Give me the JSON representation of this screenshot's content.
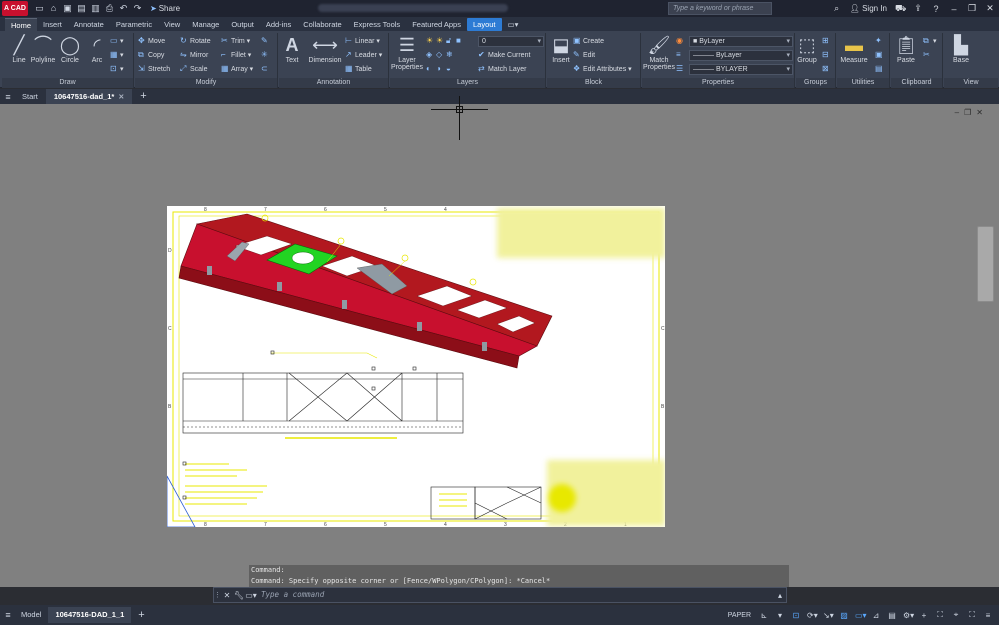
{
  "app": {
    "logo_text": "A CAD",
    "share_label": "Share"
  },
  "search": {
    "placeholder": "Type a keyword or phrase"
  },
  "account": {
    "sign_in_label": "Sign In"
  },
  "ribbon_tabs": [
    "Home",
    "Insert",
    "Annotate",
    "Parametric",
    "View",
    "Manage",
    "Output",
    "Add-ins",
    "Collaborate",
    "Express Tools",
    "Featured Apps",
    "Layout"
  ],
  "panels": {
    "draw": {
      "title": "Draw",
      "tools": [
        "Line",
        "Polyline",
        "Circle",
        "Arc"
      ]
    },
    "modify": {
      "title": "Modify",
      "tools": [
        "Move",
        "Rotate",
        "Trim",
        "Copy",
        "Mirror",
        "Fillet",
        "Stretch",
        "Scale",
        "Array"
      ]
    },
    "annotation": {
      "title": "Annotation",
      "tools": [
        "Text",
        "Dimension",
        "Linear",
        "Leader",
        "Table"
      ]
    },
    "layers": {
      "title": "Layers",
      "tools": [
        "Layer Properties",
        "Make Current",
        "Match Layer"
      ],
      "current_layer": "0"
    },
    "block": {
      "title": "Block",
      "tools": [
        "Insert",
        "Create",
        "Edit",
        "Edit Attributes"
      ]
    },
    "properties": {
      "title": "Properties",
      "tools": [
        "Match Properties"
      ],
      "color": "ByLayer",
      "linetype": "ByLayer",
      "lineweight": "BYLAYER"
    },
    "groups": {
      "title": "Groups",
      "tools": [
        "Group"
      ]
    },
    "utilities": {
      "title": "Utilities",
      "tools": [
        "Measure"
      ]
    },
    "clipboard": {
      "title": "Clipboard",
      "tools": [
        "Paste"
      ]
    },
    "view": {
      "title": "View",
      "tools": [
        "Base"
      ]
    }
  },
  "doc_tabs": {
    "start": "Start",
    "drawing": "10647516-dad_1*"
  },
  "sheet": {
    "col_labels": [
      "8",
      "7",
      "6",
      "5",
      "4",
      "3",
      "2",
      "1"
    ],
    "row_labels": [
      "D",
      "C",
      "B",
      "A"
    ]
  },
  "command": {
    "history": [
      "Command:",
      "Command: Specify opposite corner or [Fence/WPolygon/CPolygon]: *Cancel*"
    ],
    "placeholder": "Type a command"
  },
  "layout_tabs": {
    "model": "Model",
    "layout": "10647516-DAD_1_1"
  },
  "status": {
    "space": "PAPER"
  },
  "colors": {
    "frame": "#c8102e",
    "plate": "#22d422",
    "paper_border": "#e8e800",
    "accent": "#2d7bd4"
  }
}
